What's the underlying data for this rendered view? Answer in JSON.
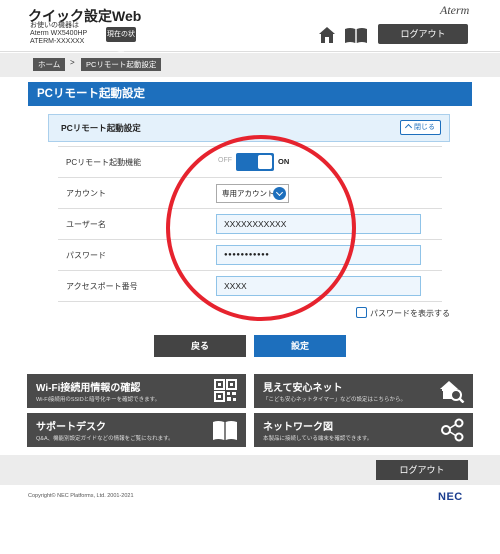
{
  "header": {
    "app_title": "クイック設定Web",
    "device_label": "お使いの機器は",
    "device_model": "Aterm WX5400HP",
    "device_id": "ATERM-XXXXXX",
    "status_button": "現在の状態",
    "brand_logo": "Aterm",
    "logout_label": "ログアウト",
    "home_icon": "home-icon",
    "manual_icon": "book-icon"
  },
  "breadcrumb": {
    "home": "ホーム",
    "separator": ">",
    "current": "PCリモート起動設定"
  },
  "page_title": "PCリモート起動設定",
  "panel": {
    "title": "PCリモート起動設定",
    "collapse_label": "閉じる"
  },
  "form": {
    "rows": [
      {
        "label": "PCリモート起動機能",
        "type": "toggle",
        "off_label": "OFF",
        "on_label": "ON",
        "state": "ON"
      },
      {
        "label": "アカウント",
        "type": "select",
        "value": "専用アカウント"
      },
      {
        "label": "ユーザー名",
        "type": "input",
        "value": "XXXXXXXXXXX"
      },
      {
        "label": "パスワード",
        "type": "password",
        "value": "●●●●●●●●●●●"
      },
      {
        "label": "アクセスポート番号",
        "type": "input",
        "value": "XXXX"
      }
    ],
    "show_password_label": "パスワードを表示する",
    "show_password_checked": false
  },
  "actions": {
    "back_label": "戻る",
    "set_label": "設定"
  },
  "tiles": [
    {
      "title": "Wi-Fi接続用情報の確認",
      "desc": "Wi-Fi接続用のSSIDと暗号化キーを確認できます。",
      "icon": "qr-code-icon"
    },
    {
      "title": "見えて安心ネット",
      "desc": "「こども安心ネットタイマー」などの設定はこちらから。",
      "icon": "home-search-icon"
    },
    {
      "title": "サポートデスク",
      "desc": "Q&A、機能別設定ガイドなどの情報をご覧になれます。",
      "icon": "book-icon"
    },
    {
      "title": "ネットワーク図",
      "desc": "本製品に接続している端末を確認できます。",
      "icon": "network-icon"
    }
  ],
  "footer": {
    "logout_label": "ログアウト",
    "copyright": "Copyright© NEC Platforms, Ltd. 2001-2021",
    "nec_logo": "NEC"
  },
  "colors": {
    "accent": "#1d6fbd",
    "dark": "#444444",
    "annotation": "#e6232e"
  }
}
